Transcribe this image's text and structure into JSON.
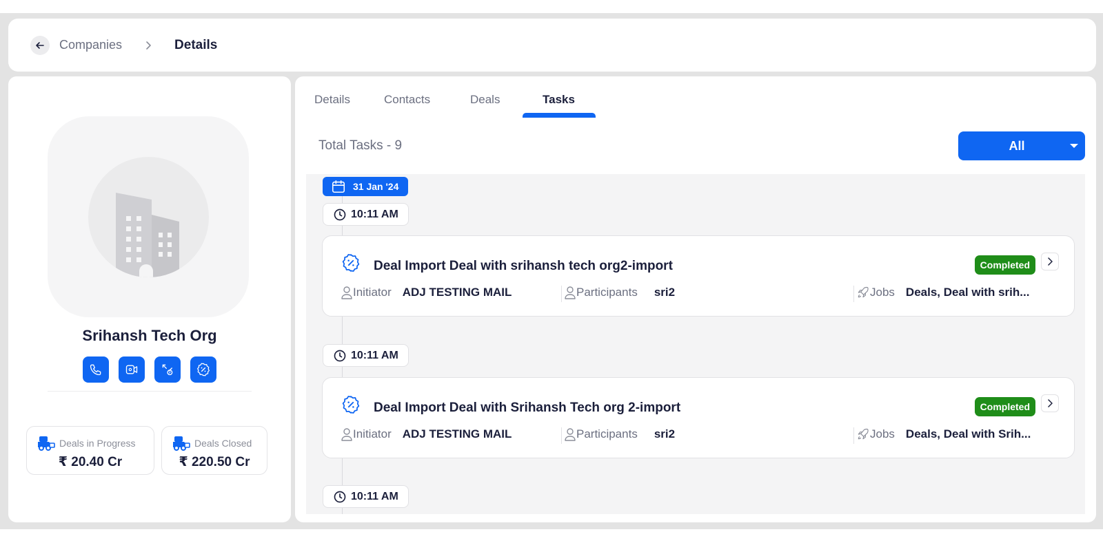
{
  "breadcrumb": {
    "parent": "Companies",
    "current": "Details"
  },
  "company": {
    "name": "Srihansh Tech Org",
    "actions": [
      "phone-icon",
      "video-icon",
      "deal-icon",
      "discount-icon"
    ],
    "stats": [
      {
        "label": "Deals in Progress",
        "value": "₹ 20.40 Cr"
      },
      {
        "label": "Deals Closed",
        "value": "₹ 220.50 Cr"
      }
    ]
  },
  "tabs": [
    "Details",
    "Contacts",
    "Deals",
    "Tasks"
  ],
  "active_tab": "Tasks",
  "tasks_header": {
    "total": "Total Tasks - 9",
    "filter": "All"
  },
  "timeline": {
    "date": "31 Jan '24",
    "times": [
      "10:11 AM",
      "10:11 AM",
      "10:11 AM"
    ],
    "tasks": [
      {
        "title": "Deal Import Deal with srihansh tech org2-import",
        "status": "Completed",
        "initiator_label": "Initiator",
        "initiator": "ADJ TESTING MAIL",
        "participants_label": "Participants",
        "participants": "sri2",
        "jobs_label": "Jobs",
        "jobs": "Deals, Deal with srih..."
      },
      {
        "title": "Deal Import Deal with Srihansh Tech org 2-import",
        "status": "Completed",
        "initiator_label": "Initiator",
        "initiator": "ADJ TESTING MAIL",
        "participants_label": "Participants",
        "participants": "sri2",
        "jobs_label": "Jobs",
        "jobs": "Deals, Deal with Srih..."
      }
    ]
  },
  "colors": {
    "accent": "#0f66f2",
    "success": "#1f8d19",
    "text": "#1b1f3b",
    "muted": "#6b6f80"
  }
}
